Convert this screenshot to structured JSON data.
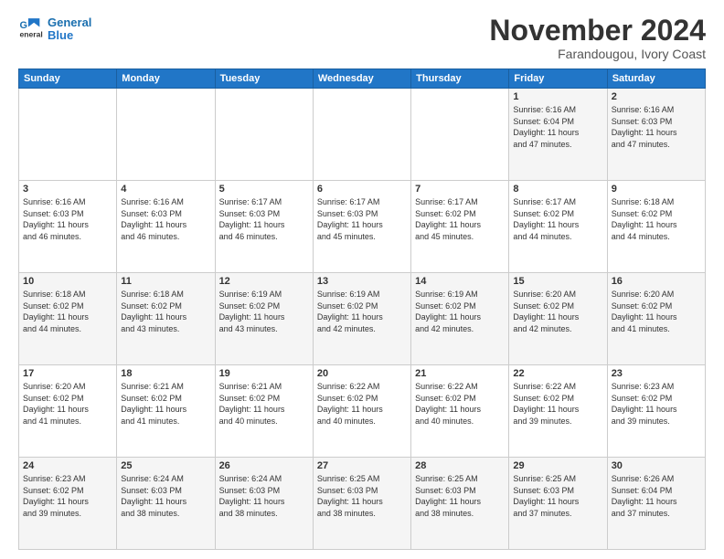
{
  "header": {
    "logo_line1": "General",
    "logo_line2": "Blue",
    "month": "November 2024",
    "location": "Farandougou, Ivory Coast"
  },
  "weekdays": [
    "Sunday",
    "Monday",
    "Tuesday",
    "Wednesday",
    "Thursday",
    "Friday",
    "Saturday"
  ],
  "weeks": [
    [
      {
        "day": "",
        "text": ""
      },
      {
        "day": "",
        "text": ""
      },
      {
        "day": "",
        "text": ""
      },
      {
        "day": "",
        "text": ""
      },
      {
        "day": "",
        "text": ""
      },
      {
        "day": "1",
        "text": "Sunrise: 6:16 AM\nSunset: 6:04 PM\nDaylight: 11 hours\nand 47 minutes."
      },
      {
        "day": "2",
        "text": "Sunrise: 6:16 AM\nSunset: 6:03 PM\nDaylight: 11 hours\nand 47 minutes."
      }
    ],
    [
      {
        "day": "3",
        "text": "Sunrise: 6:16 AM\nSunset: 6:03 PM\nDaylight: 11 hours\nand 46 minutes."
      },
      {
        "day": "4",
        "text": "Sunrise: 6:16 AM\nSunset: 6:03 PM\nDaylight: 11 hours\nand 46 minutes."
      },
      {
        "day": "5",
        "text": "Sunrise: 6:17 AM\nSunset: 6:03 PM\nDaylight: 11 hours\nand 46 minutes."
      },
      {
        "day": "6",
        "text": "Sunrise: 6:17 AM\nSunset: 6:03 PM\nDaylight: 11 hours\nand 45 minutes."
      },
      {
        "day": "7",
        "text": "Sunrise: 6:17 AM\nSunset: 6:02 PM\nDaylight: 11 hours\nand 45 minutes."
      },
      {
        "day": "8",
        "text": "Sunrise: 6:17 AM\nSunset: 6:02 PM\nDaylight: 11 hours\nand 44 minutes."
      },
      {
        "day": "9",
        "text": "Sunrise: 6:18 AM\nSunset: 6:02 PM\nDaylight: 11 hours\nand 44 minutes."
      }
    ],
    [
      {
        "day": "10",
        "text": "Sunrise: 6:18 AM\nSunset: 6:02 PM\nDaylight: 11 hours\nand 44 minutes."
      },
      {
        "day": "11",
        "text": "Sunrise: 6:18 AM\nSunset: 6:02 PM\nDaylight: 11 hours\nand 43 minutes."
      },
      {
        "day": "12",
        "text": "Sunrise: 6:19 AM\nSunset: 6:02 PM\nDaylight: 11 hours\nand 43 minutes."
      },
      {
        "day": "13",
        "text": "Sunrise: 6:19 AM\nSunset: 6:02 PM\nDaylight: 11 hours\nand 42 minutes."
      },
      {
        "day": "14",
        "text": "Sunrise: 6:19 AM\nSunset: 6:02 PM\nDaylight: 11 hours\nand 42 minutes."
      },
      {
        "day": "15",
        "text": "Sunrise: 6:20 AM\nSunset: 6:02 PM\nDaylight: 11 hours\nand 42 minutes."
      },
      {
        "day": "16",
        "text": "Sunrise: 6:20 AM\nSunset: 6:02 PM\nDaylight: 11 hours\nand 41 minutes."
      }
    ],
    [
      {
        "day": "17",
        "text": "Sunrise: 6:20 AM\nSunset: 6:02 PM\nDaylight: 11 hours\nand 41 minutes."
      },
      {
        "day": "18",
        "text": "Sunrise: 6:21 AM\nSunset: 6:02 PM\nDaylight: 11 hours\nand 41 minutes."
      },
      {
        "day": "19",
        "text": "Sunrise: 6:21 AM\nSunset: 6:02 PM\nDaylight: 11 hours\nand 40 minutes."
      },
      {
        "day": "20",
        "text": "Sunrise: 6:22 AM\nSunset: 6:02 PM\nDaylight: 11 hours\nand 40 minutes."
      },
      {
        "day": "21",
        "text": "Sunrise: 6:22 AM\nSunset: 6:02 PM\nDaylight: 11 hours\nand 40 minutes."
      },
      {
        "day": "22",
        "text": "Sunrise: 6:22 AM\nSunset: 6:02 PM\nDaylight: 11 hours\nand 39 minutes."
      },
      {
        "day": "23",
        "text": "Sunrise: 6:23 AM\nSunset: 6:02 PM\nDaylight: 11 hours\nand 39 minutes."
      }
    ],
    [
      {
        "day": "24",
        "text": "Sunrise: 6:23 AM\nSunset: 6:02 PM\nDaylight: 11 hours\nand 39 minutes."
      },
      {
        "day": "25",
        "text": "Sunrise: 6:24 AM\nSunset: 6:03 PM\nDaylight: 11 hours\nand 38 minutes."
      },
      {
        "day": "26",
        "text": "Sunrise: 6:24 AM\nSunset: 6:03 PM\nDaylight: 11 hours\nand 38 minutes."
      },
      {
        "day": "27",
        "text": "Sunrise: 6:25 AM\nSunset: 6:03 PM\nDaylight: 11 hours\nand 38 minutes."
      },
      {
        "day": "28",
        "text": "Sunrise: 6:25 AM\nSunset: 6:03 PM\nDaylight: 11 hours\nand 38 minutes."
      },
      {
        "day": "29",
        "text": "Sunrise: 6:25 AM\nSunset: 6:03 PM\nDaylight: 11 hours\nand 37 minutes."
      },
      {
        "day": "30",
        "text": "Sunrise: 6:26 AM\nSunset: 6:04 PM\nDaylight: 11 hours\nand 37 minutes."
      }
    ]
  ]
}
